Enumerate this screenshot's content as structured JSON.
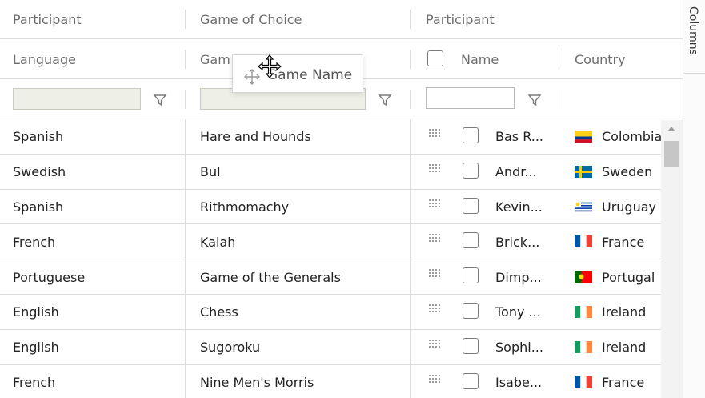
{
  "header": {
    "group_row": {
      "group1": "Participant",
      "group2": "Game of Choice",
      "group3": "Participant"
    },
    "columns": {
      "language": "Language",
      "game_partial": "Gam",
      "name": "Name",
      "country": "Country"
    }
  },
  "drag_ghost": {
    "label": "Game Name"
  },
  "sidebar": {
    "columns_label": "Columns"
  },
  "rows": [
    {
      "language": "Spanish",
      "game": "Hare and Hounds",
      "name": "Bas R...",
      "country": "Colombia"
    },
    {
      "language": "Swedish",
      "game": "Bul",
      "name": "Andr...",
      "country": "Sweden"
    },
    {
      "language": "Spanish",
      "game": "Rithmomachy",
      "name": "Kevin...",
      "country": "Uruguay"
    },
    {
      "language": "French",
      "game": "Kalah",
      "name": "Brick...",
      "country": "France"
    },
    {
      "language": "Portuguese",
      "game": "Game of the Generals",
      "name": "Dimp...",
      "country": "Portugal"
    },
    {
      "language": "English",
      "game": "Chess",
      "name": "Tony ...",
      "country": "Ireland"
    },
    {
      "language": "English",
      "game": "Sugoroku",
      "name": "Sophi...",
      "country": "Ireland"
    },
    {
      "language": "French",
      "game": "Nine Men's Morris",
      "name": "Isabe...",
      "country": "France"
    }
  ],
  "flags": {
    "Colombia": "colombia-flag-icon",
    "Sweden": "sweden-flag-icon",
    "Uruguay": "uruguay-flag-icon",
    "France": "france-flag-icon",
    "Portugal": "portugal-flag-icon",
    "Ireland": "ireland-flag-icon"
  },
  "colors": {
    "header_text": "#6d6d6d",
    "border": "#dcdcdc",
    "disabled_filter_bg": "#eef0e8"
  }
}
